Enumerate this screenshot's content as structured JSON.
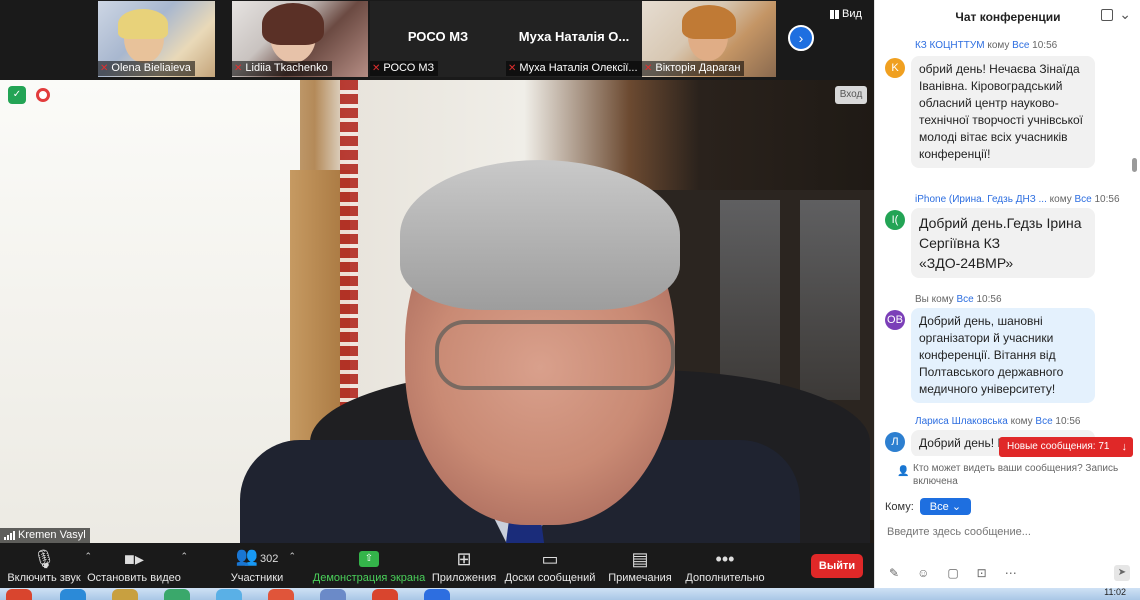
{
  "strip": {
    "thumbnails": [
      {
        "name": "Olena Bieliaieva"
      },
      {
        "name": "Lidiia Tkachenko"
      },
      {
        "name": "РОСО МЗ",
        "center": "РОСО МЗ"
      },
      {
        "name": "Муха Наталія Олексії...",
        "center": "Муха  Наталія  О..."
      },
      {
        "name": "Вікторія Дараган"
      }
    ],
    "view_label": "Вид"
  },
  "video": {
    "exit_label": "Вход",
    "speaker": "Kremen Vasyl"
  },
  "toolbar": {
    "audio": "Включить звук",
    "video": "Остановить видео",
    "participants": "Участники",
    "participants_count": "302",
    "share": "Демонстрация экрана",
    "apps": "Приложения",
    "whiteboards": "Доски сообщений",
    "notes": "Примечания",
    "more": "Дополнительно",
    "leave": "Выйти"
  },
  "chat": {
    "title": "Чат конференции",
    "messages": [
      {
        "avatar": "K",
        "avatar_color": "#f0a020",
        "sender": "КЗ КОЦНТТУМ",
        "to_word": "кому",
        "to": "Все",
        "time": "10:56",
        "text": "обрий день! Нечаєва Зінаїда Іванівна. Кіровоградський обласний центр науково-технічної творчості учнівської молоді вітає всіх учасників конференції!"
      },
      {
        "avatar": "I(",
        "avatar_color": "#23a455",
        "sender": "iPhone (Ирина. Гедзь ДНЗ ...",
        "to_word": "кому",
        "to": "Все",
        "time": "10:56",
        "text": "Добрий день.Гедзь Ірина Сергіївна КЗ «ЗДО-24ВМР»"
      },
      {
        "avatar": "OB",
        "avatar_color": "#7b3fb8",
        "sender": "Вы",
        "to_word": "кому",
        "to": "Все",
        "time": "10:56",
        "text": "Добрий день, шановні організатори й учасники конференції. Вітання від Полтавського державного медичного університету!"
      },
      {
        "avatar": "Л",
        "avatar_color": "#2d7fd0",
        "sender": "Лариса Шлаковська",
        "to_word": "кому",
        "to": "Все",
        "time": "10:56",
        "text": "Добрий день! Мироненко..."
      }
    ],
    "new_messages": "Новые сообщения: 71",
    "visibility_note": "Кто может видеть ваши сообщения? Запись включена",
    "to_label": "Кому:",
    "to_value": "Все",
    "input_placeholder": "Введите здесь сообщение..."
  },
  "taskbar": {
    "clock": "11:02"
  }
}
